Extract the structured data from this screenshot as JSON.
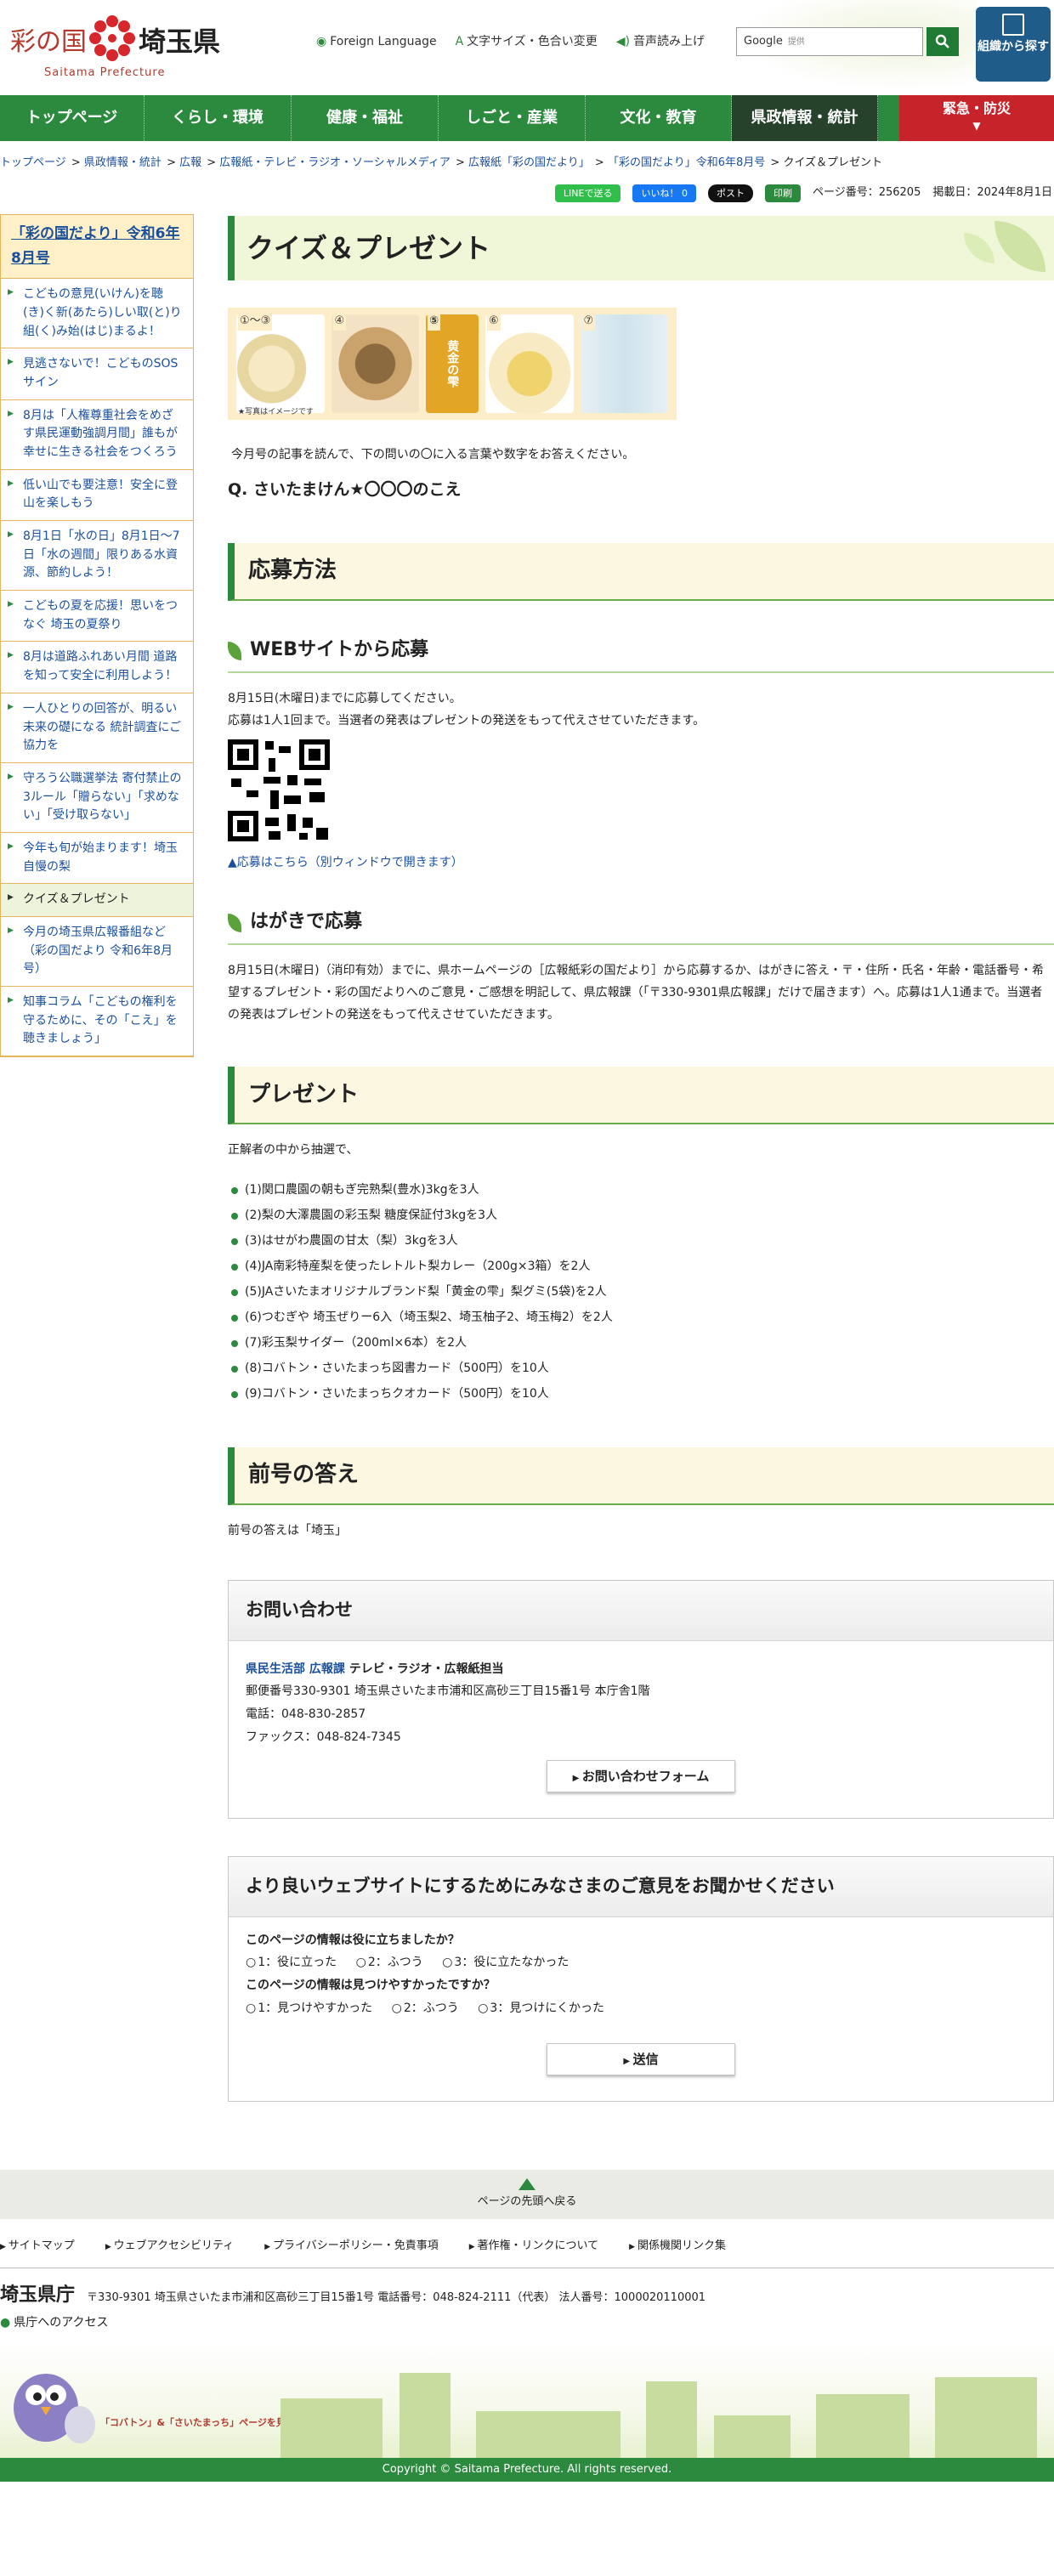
{
  "header": {
    "logo_kuni": "彩の国",
    "logo_ken": "埼玉県",
    "logo_en": "Saitama Prefecture",
    "foreign": "Foreign Language",
    "fontsize": "文字サイズ・色合い変更",
    "voice": "音声読み上げ",
    "search_brand": "Google",
    "search_placeholder": "提供",
    "org_btn": "組織から探す"
  },
  "gnav": [
    "トップページ",
    "くらし・環境",
    "健康・福祉",
    "しごと・産業",
    "文化・教育",
    "県政情報・統計"
  ],
  "gnav_urgent": "緊急・防災",
  "breadcrumb": [
    "トップページ",
    "県政情報・統計",
    "広報",
    "広報紙・テレビ・ラジオ・ソーシャルメディア",
    "広報紙「彩の国だより」",
    "「彩の国だより」令和6年8月号",
    "クイズ＆プレゼント"
  ],
  "tools": {
    "line": "LINEで送る",
    "fb": "いいね！ 0",
    "x": "ポスト",
    "print": "印刷",
    "page_no": "ページ番号：256205",
    "date": "掲載日：2024年8月1日"
  },
  "sidebar": {
    "title": "「彩の国だより」令和6年8月号",
    "items": [
      "こどもの意見(いけん)を聴(き)く新(あたら)しい取(と)り組(く)み始(はじ)まるよ！",
      "見逃さないで！こどものSOSサイン",
      "8月は「人権尊重社会をめざす県民運動強調月間」誰もが幸せに生きる社会をつくろう",
      "低い山でも要注意！安全に登山を楽しもう",
      "8月1日「水の日」8月1日～7日「水の週間」限りある水資源、節約しよう！",
      "こどもの夏を応援！思いをつなぐ 埼玉の夏祭り",
      "8月は道路ふれあい月間 道路を知って安全に利用しよう！",
      "一人ひとりの回答が、明るい未来の礎になる 統計調査にご協力を",
      "守ろう公職選挙法 寄付禁止の3ルール「贈らない」「求めない」「受け取らない」",
      "今年も旬が始まります！埼玉自慢の梨",
      "クイズ＆プレゼント",
      "今月の埼玉県広報番組など（彩の国だより 令和6年8月号）",
      "知事コラム「こどもの権利を守るために、その「こえ」を聴きましょう」"
    ]
  },
  "main": {
    "title": "クイズ＆プレゼント",
    "image_labels": [
      "①～③",
      "④",
      "⑤",
      "⑥",
      "⑦"
    ],
    "image_note": "★写真はイメージです",
    "image_text5": "黄金の雫",
    "intro": "今月号の記事を読んで、下の問いの〇に入る言葉や数字をお答えください。",
    "question": "Q. さいたまけん★〇〇〇のこえ",
    "h_apply": "応募方法",
    "h_web": "WEBサイトから応募",
    "web_p1": "8月15日(木曜日)までに応募してください。",
    "web_p2": "応募は1人1回まで。当選者の発表はプレゼントの発送をもって代えさせていただきます。",
    "web_link": "▲応募はこちら（別ウィンドウで開きます）",
    "h_post": "はがきで応募",
    "post_p": "8月15日(木曜日)（消印有効）までに、県ホームページの［広報紙彩の国だより］から応募するか、はがきに答え・〒・住所・氏名・年齢・電話番号・希望するプレゼント・彩の国だよりへのご意見・ご感想を明記して、県広報課（「〒330-9301県広報課」だけで届きます）へ。応募は1人1通まで。当選者の発表はプレゼントの発送をもって代えさせていただきます。",
    "h_present": "プレゼント",
    "present_intro": "正解者の中から抽選で、",
    "presents": [
      "(1)関口農園の朝もぎ完熟梨(豊水)3kgを3人",
      "(2)梨の大澤農園の彩玉梨 糖度保証付3kgを3人",
      "(3)はせがわ農園の甘太（梨）3kgを3人",
      "(4)JA南彩特産梨を使ったレトルト梨カレー（200g×3箱）を2人",
      "(5)JAさいたまオリジナルブランド梨「黄金の雫」梨グミ(5袋)を2人",
      "(6)つむぎや 埼玉ぜりー6入（埼玉梨2、埼玉柚子2、埼玉梅2）を2人",
      "(7)彩玉梨サイダー（200ml×6本）を2人",
      "(8)コバトン・さいたまっち図書カード（500円）を10人",
      "(9)コバトン・さいたまっちクオカード（500円）を10人"
    ],
    "h_answer": "前号の答え",
    "answer": "前号の答えは「埼玉」"
  },
  "contact": {
    "title": "お問い合わせ",
    "dept1": "県民生活部",
    "dept2": "広報課",
    "dept3": "テレビ・ラジオ・広報紙担当",
    "address": "郵便番号330-9301 埼玉県さいたま市浦和区高砂三丁目15番1号 本庁舎1階",
    "tel": "電話：048-830-2857",
    "fax": "ファックス：048-824-7345",
    "form_btn": "お問い合わせフォーム"
  },
  "survey": {
    "title": "より良いウェブサイトにするためにみなさまのご意見をお聞かせください",
    "q1": "このページの情報は役に立ちましたか？",
    "q1_opts": [
      "1：役に立った",
      "2：ふつう",
      "3：役に立たなかった"
    ],
    "q2": "このページの情報は見つけやすかったですか？",
    "q2_opts": [
      "1：見つけやすかった",
      "2：ふつう",
      "3：見つけにくかった"
    ],
    "submit": "送信"
  },
  "footer": {
    "pagetop": "ページの先頭へ戻る",
    "links": [
      "サイトマップ",
      "ウェブアクセシビリティ",
      "プライバシーポリシー・免責事項",
      "著作権・リンクについて",
      "関係機関リンク集"
    ],
    "name": "埼玉県庁",
    "address": "〒330-9301 埼玉県さいたま市浦和区高砂三丁目15番1号 電話番号：048-824-2111（代表） 法人番号：1000020110001",
    "access": "県庁へのアクセス",
    "kobaton": "「コバトン」&「さいたまっち」ページを見る",
    "copyright": "Copyright © Saitama Prefecture. All rights reserved."
  },
  "colors": {
    "green": "#2b8a3e",
    "dark_green": "#26422b",
    "red": "#c7232a",
    "link": "#1a4f9c"
  }
}
